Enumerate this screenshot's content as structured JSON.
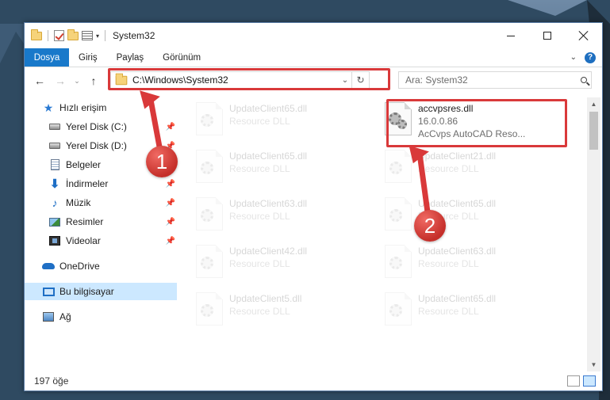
{
  "window": {
    "title": "System32",
    "tabs": {
      "file": "Dosya",
      "home": "Giriş",
      "share": "Paylaş",
      "view": "Görünüm"
    },
    "help": "?"
  },
  "address": {
    "path": "C:\\Windows\\System32",
    "search_placeholder": "Ara: System32"
  },
  "nav": {
    "items": [
      {
        "label": "Hızlı erişim",
        "icon": "star-icon"
      },
      {
        "label": "Yerel Disk (C:)",
        "icon": "drive-icon",
        "pinned": true
      },
      {
        "label": "Yerel Disk (D:)",
        "icon": "drive-icon",
        "pinned": true
      },
      {
        "label": "Belgeler",
        "icon": "documents-icon",
        "pinned": true
      },
      {
        "label": "İndirmeler",
        "icon": "download-icon",
        "pinned": true
      },
      {
        "label": "Müzik",
        "icon": "music-icon",
        "pinned": true
      },
      {
        "label": "Resimler",
        "icon": "pictures-icon",
        "pinned": true
      },
      {
        "label": "Videolar",
        "icon": "videos-icon",
        "pinned": true
      },
      {
        "label": "OneDrive",
        "icon": "onedrive-icon"
      },
      {
        "label": "Bu bilgisayar",
        "icon": "computer-icon",
        "selected": true
      },
      {
        "label": "Ağ",
        "icon": "network-icon"
      }
    ]
  },
  "files": {
    "highlighted": {
      "name": "accvpsres.dll",
      "version": "16.0.0.86",
      "description": "AcCvps AutoCAD Reso..."
    },
    "left_column": [
      {
        "name": "UpdateClient65.dll",
        "type": "Resource DLL"
      },
      {
        "name": "UpdateClient65.dll",
        "type": "Resource DLL"
      },
      {
        "name": "UpdateClient63.dll",
        "type": "Resource DLL"
      },
      {
        "name": "UpdateClient42.dll",
        "type": "Resource DLL"
      },
      {
        "name": "UpdateClient5.dll",
        "type": "Resource DLL"
      }
    ],
    "right_column": [
      {
        "name": "UpdateClient21.dll",
        "type": "Resource DLL"
      },
      {
        "name": "UpdateClient65.dll",
        "type": "Resource DLL"
      },
      {
        "name": "UpdateClient63.dll",
        "type": "Resource DLL"
      },
      {
        "name": "UpdateClient65.dll",
        "type": "Resource DLL"
      }
    ]
  },
  "status": {
    "item_count": "197 öğe"
  },
  "annotations": {
    "badge1": "1",
    "badge2": "2",
    "color": "#d9393a"
  }
}
